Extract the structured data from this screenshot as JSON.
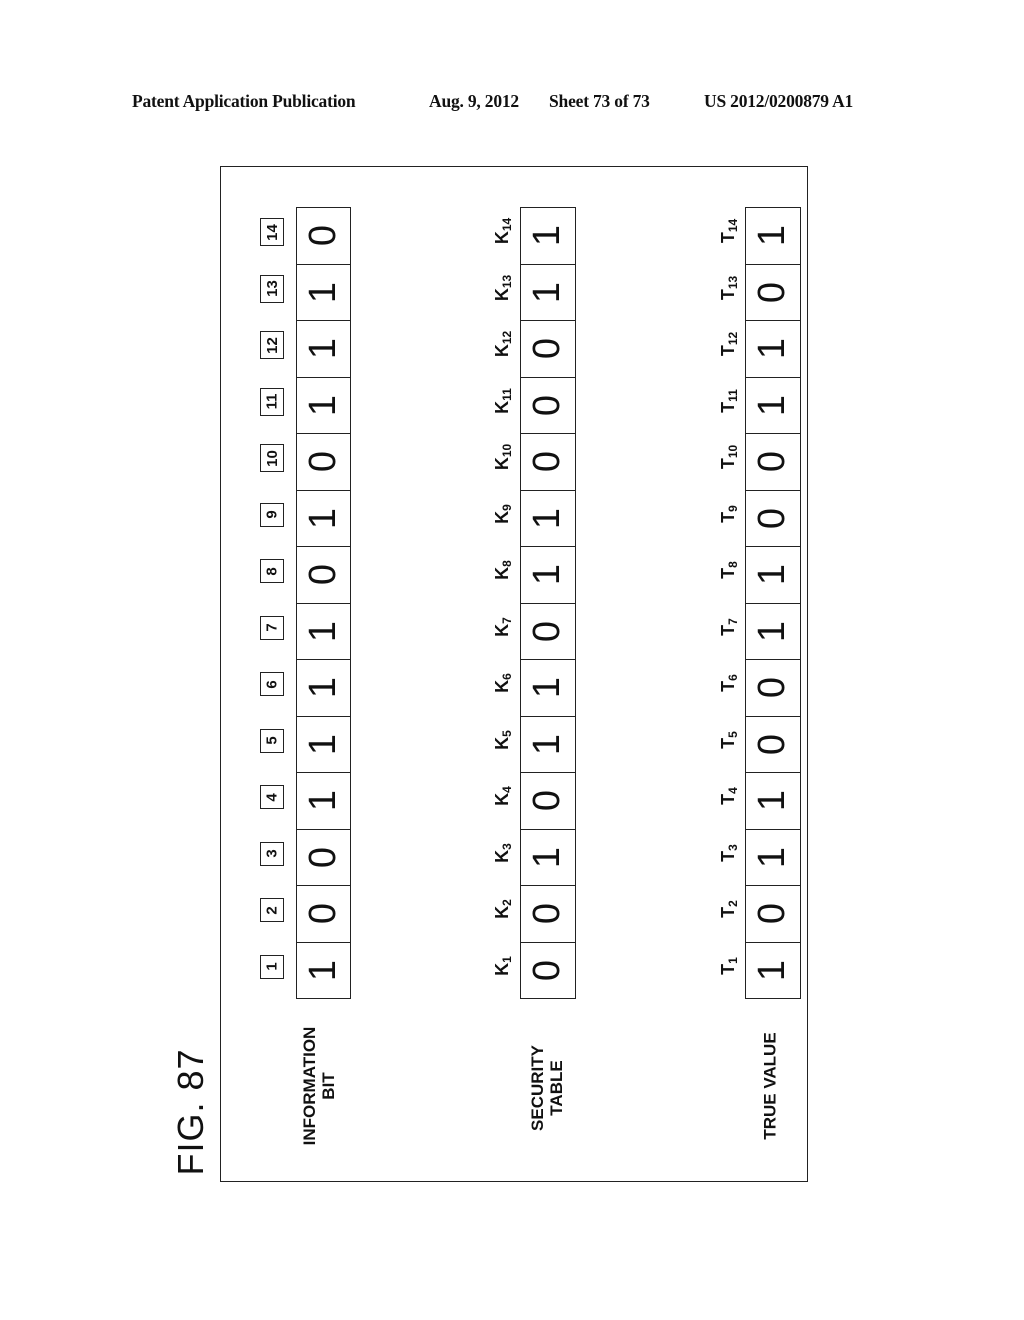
{
  "header": {
    "publication": "Patent Application Publication",
    "date": "Aug. 9, 2012",
    "sheet": "Sheet 73 of 73",
    "number": "US 2012/0200879 A1"
  },
  "figure": {
    "label": "FIG. 87",
    "rows": [
      {
        "id": "information-bit",
        "label_lines": [
          "INFORMATION",
          "BIT"
        ],
        "index_labels": [
          "1",
          "2",
          "3",
          "4",
          "5",
          "6",
          "7",
          "8",
          "9",
          "10",
          "11",
          "12",
          "13",
          "14"
        ],
        "values": [
          "1",
          "0",
          "0",
          "1",
          "1",
          "1",
          "1",
          "0",
          "1",
          "0",
          "1",
          "1",
          "1",
          "0"
        ]
      },
      {
        "id": "security-table",
        "label_lines": [
          "SECURITY",
          "TABLE"
        ],
        "symbol": "K",
        "index_labels": [
          "1",
          "2",
          "3",
          "4",
          "5",
          "6",
          "7",
          "8",
          "9",
          "10",
          "11",
          "12",
          "13",
          "14"
        ],
        "values": [
          "0",
          "0",
          "1",
          "0",
          "1",
          "1",
          "0",
          "1",
          "1",
          "0",
          "0",
          "0",
          "1",
          "1"
        ]
      },
      {
        "id": "true-value",
        "label_lines": [
          "TRUE VALUE"
        ],
        "symbol": "T",
        "index_labels": [
          "1",
          "2",
          "3",
          "4",
          "5",
          "6",
          "7",
          "8",
          "9",
          "10",
          "11",
          "12",
          "13",
          "14"
        ],
        "values": [
          "1",
          "0",
          "1",
          "1",
          "0",
          "0",
          "1",
          "1",
          "0",
          "0",
          "1",
          "1",
          "0",
          "1"
        ]
      }
    ]
  }
}
